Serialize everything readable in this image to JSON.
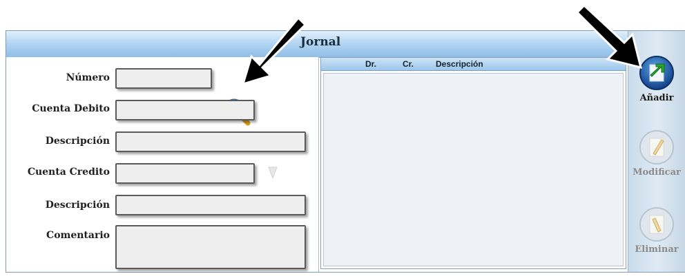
{
  "window": {
    "title": "Jornal"
  },
  "form": {
    "numero_label": "Número",
    "cuenta_debito_label": "Cuenta Debito",
    "descripcion1_label": "Descripción",
    "cuenta_credito_label": "Cuenta Credito",
    "descripcion2_label": "Descripción",
    "comentario_label": "Comentario",
    "numero_value": "",
    "cuenta_debito_value": "",
    "descripcion1_value": "",
    "cuenta_credito_value": "",
    "descripcion2_value": "",
    "comentario_value": ""
  },
  "grid": {
    "columns": [
      "Dr.",
      "Cr.",
      "Descripción"
    ]
  },
  "toolbar": {
    "add_label": "Añadir",
    "modify_label": "Modificar",
    "delete_label": "Eliminar"
  },
  "icons": {
    "search": "magnifier-icon",
    "add": "add-entry-icon",
    "modify": "edit-pencil-icon",
    "delete": "delete-pencil-icon",
    "annotation": "arrow-icon"
  },
  "colors": {
    "title_bar": "#b5d6f2",
    "add_button": "#1e5aa8",
    "disabled_text": "#8a8a8a",
    "active_text": "#1a1a1a"
  }
}
